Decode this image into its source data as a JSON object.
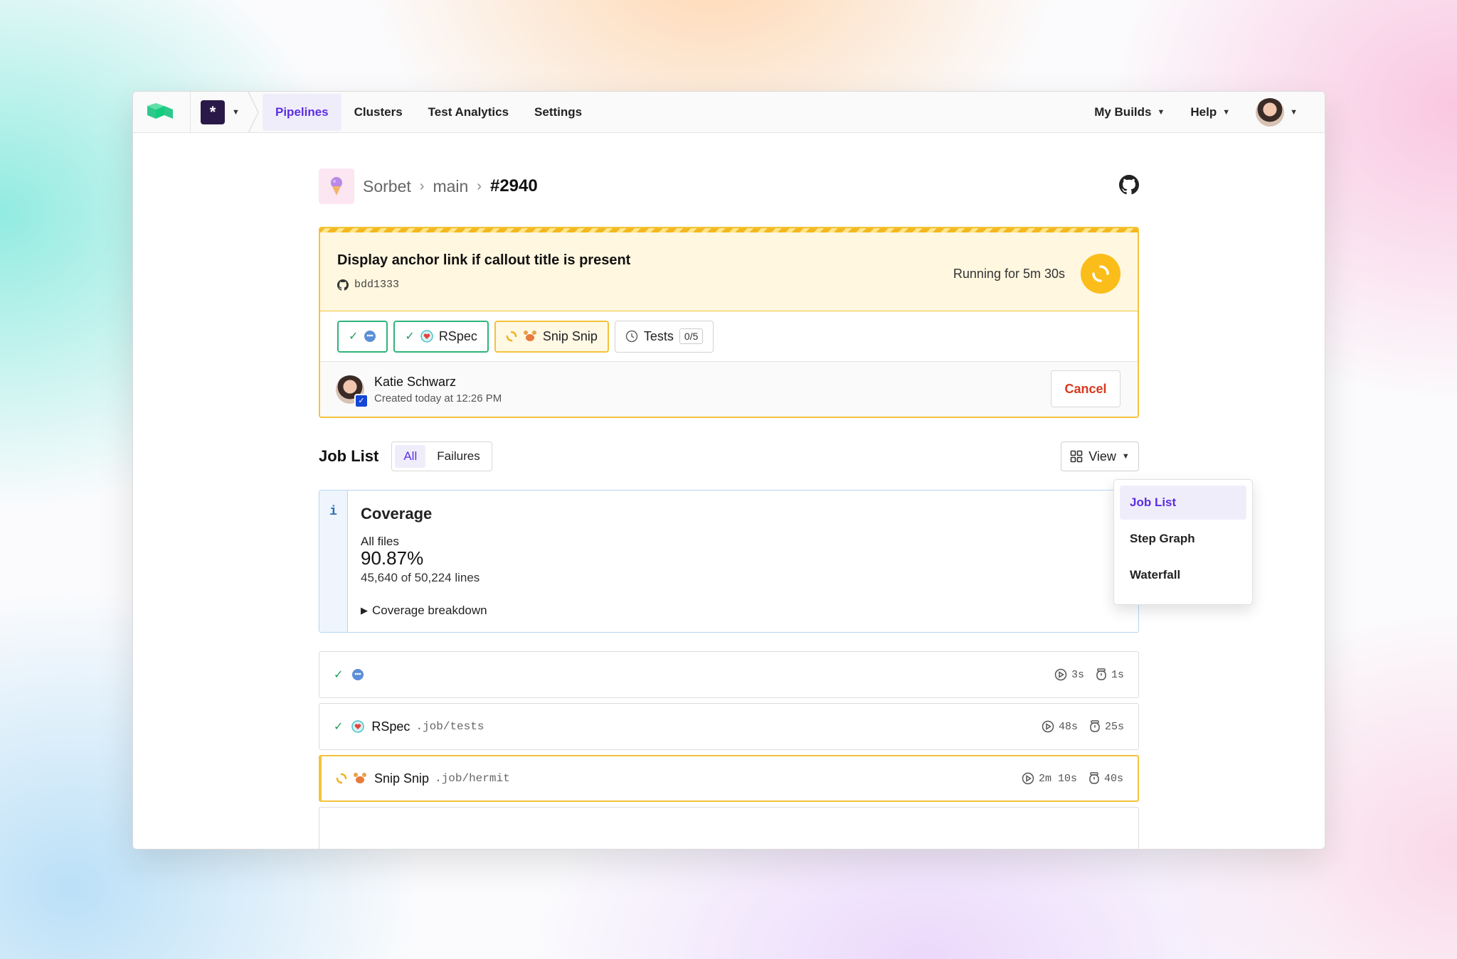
{
  "nav": {
    "items": [
      {
        "label": "Pipelines",
        "active": true
      },
      {
        "label": "Clusters",
        "active": false
      },
      {
        "label": "Test Analytics",
        "active": false
      },
      {
        "label": "Settings",
        "active": false
      }
    ],
    "org_badge": "*",
    "my_builds": "My Builds",
    "help": "Help"
  },
  "breadcrumb": {
    "pipeline": "Sorbet",
    "branch": "main",
    "build": "#2940"
  },
  "build": {
    "title": "Display anchor link if callout title is present",
    "commit": "bdd1333",
    "status_text": "Running for 5m 30s",
    "accent": "#f3c33b"
  },
  "chips": [
    {
      "label": "",
      "state": "passed",
      "icon": "blob-emoji-icon"
    },
    {
      "label": "RSpec",
      "state": "passed",
      "icon": "rspec-icon"
    },
    {
      "label": "Snip Snip",
      "state": "running",
      "icon": "crab-emoji-icon"
    },
    {
      "label": "Tests",
      "state": "waiting",
      "badge": "0/5",
      "icon": "clock-icon"
    }
  ],
  "creator": {
    "name": "Katie Schwarz",
    "created": "Created today at 12:26 PM",
    "cancel_label": "Cancel"
  },
  "job_list": {
    "title": "Job List",
    "filters": [
      {
        "label": "All",
        "active": true
      },
      {
        "label": "Failures",
        "active": false
      }
    ],
    "view_label": "View"
  },
  "view_menu": {
    "items": [
      {
        "label": "Job List",
        "active": true
      },
      {
        "label": "Step Graph",
        "active": false
      },
      {
        "label": "Waterfall",
        "active": false
      }
    ]
  },
  "coverage": {
    "info_glyph": "i",
    "title": "Coverage",
    "subtitle": "All files",
    "percent": "90.87%",
    "lines": "45,640 of 50,224 lines",
    "breakdown_label": "Coverage breakdown"
  },
  "jobs": [
    {
      "name": "",
      "path": "",
      "state": "passed",
      "run_time": "3s",
      "wait_time": "1s"
    },
    {
      "name": "RSpec",
      "path": ".job/tests",
      "state": "passed",
      "run_time": "48s",
      "wait_time": "25s"
    },
    {
      "name": "Snip Snip",
      "path": ".job/hermit",
      "state": "running",
      "run_time": "2m 10s",
      "wait_time": "40s"
    }
  ]
}
